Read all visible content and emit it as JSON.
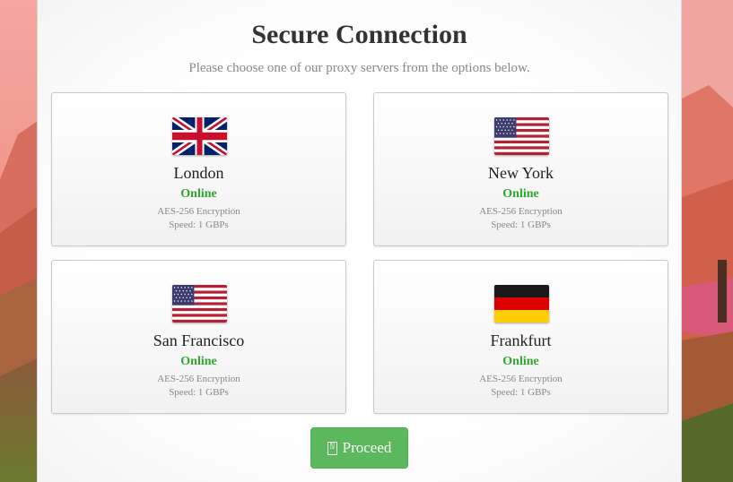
{
  "page": {
    "title": "Secure Connection",
    "subtitle": "Please choose one of our proxy servers from the options below."
  },
  "servers": [
    {
      "city": "London",
      "status": "Online",
      "encryption": "AES-256 Encryption",
      "speed": "Speed: 1 GBPs",
      "flag": "uk-flag-icon"
    },
    {
      "city": "New York",
      "status": "Online",
      "encryption": "AES-256 Encryption",
      "speed": "Speed: 1 GBPs",
      "flag": "us-flag-icon"
    },
    {
      "city": "San Francisco",
      "status": "Online",
      "encryption": "AES-256 Encryption",
      "speed": "Speed: 1 GBPs",
      "flag": "us-flag-icon"
    },
    {
      "city": "Frankfurt",
      "status": "Online",
      "encryption": "AES-256 Encryption",
      "speed": "Speed: 1 GBPs",
      "flag": "germany-flag-icon"
    }
  ],
  "proceed": {
    "label": "Proceed",
    "icon": "glyph-box-icon",
    "icon_glyph": "⍂"
  },
  "colors": {
    "status_online": "#2ea52e",
    "button": "#5cb85c",
    "background": "#e07a6a"
  }
}
